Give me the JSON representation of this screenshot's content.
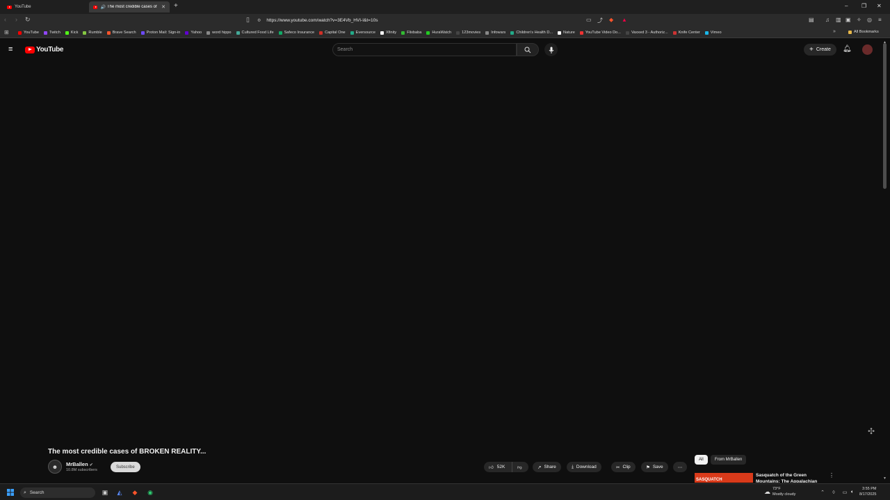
{
  "browser": {
    "tabs": [
      {
        "label": "YouTube",
        "active": false
      },
      {
        "label": "The most credible cases of B",
        "active": true
      }
    ],
    "url": "https://www.youtube.com/watch?v=3E4Vb_HVI-I&t=10s",
    "bookmarks": [
      "YouTube",
      "Twitch",
      "Kick",
      "Rumble",
      "Brave Search",
      "Proton Mail: Sign-in",
      "Yahoo",
      "word hippo",
      "Cultured Food Life",
      "Safeco Insurance",
      "Capital One",
      "Eversource",
      "Xfinity",
      "Flixbaba",
      "HuraWatch",
      "123movies",
      "Infowars",
      "Children's Health D...",
      "Nature",
      "YouTube Video Do...",
      "Vaxxed 3 - Authoriz...",
      "Knife Center",
      "Vimeo"
    ],
    "all_bookmarks_label": "All Bookmarks"
  },
  "youtube": {
    "logo_text": "YouTube",
    "search_placeholder": "Search",
    "create_label": "Create",
    "video_title": "The most credible cases of BROKEN REALITY...",
    "channel_name": "MrBallen",
    "subscriber_count": "10.8M subscribers",
    "subscribe_label": "Subscribe",
    "like_count": "52K",
    "share_label": "Share",
    "download_label": "Download",
    "clip_label": "Clip",
    "save_label": "Save",
    "chips": [
      "All",
      "From MrBallen"
    ],
    "recommendation": {
      "title": "Sasquatch of the Green Mountains: The Appalachian",
      "thumb_text": "SASQUATCH"
    }
  },
  "taskbar": {
    "search_label": "Search",
    "weather_temp": "73°F",
    "weather_desc": "Mostly cloudy",
    "time": "3:55 PM",
    "date": "8/17/2025"
  },
  "colors": {
    "brand_red": "#ff0000",
    "background": "#0f0f0f"
  }
}
